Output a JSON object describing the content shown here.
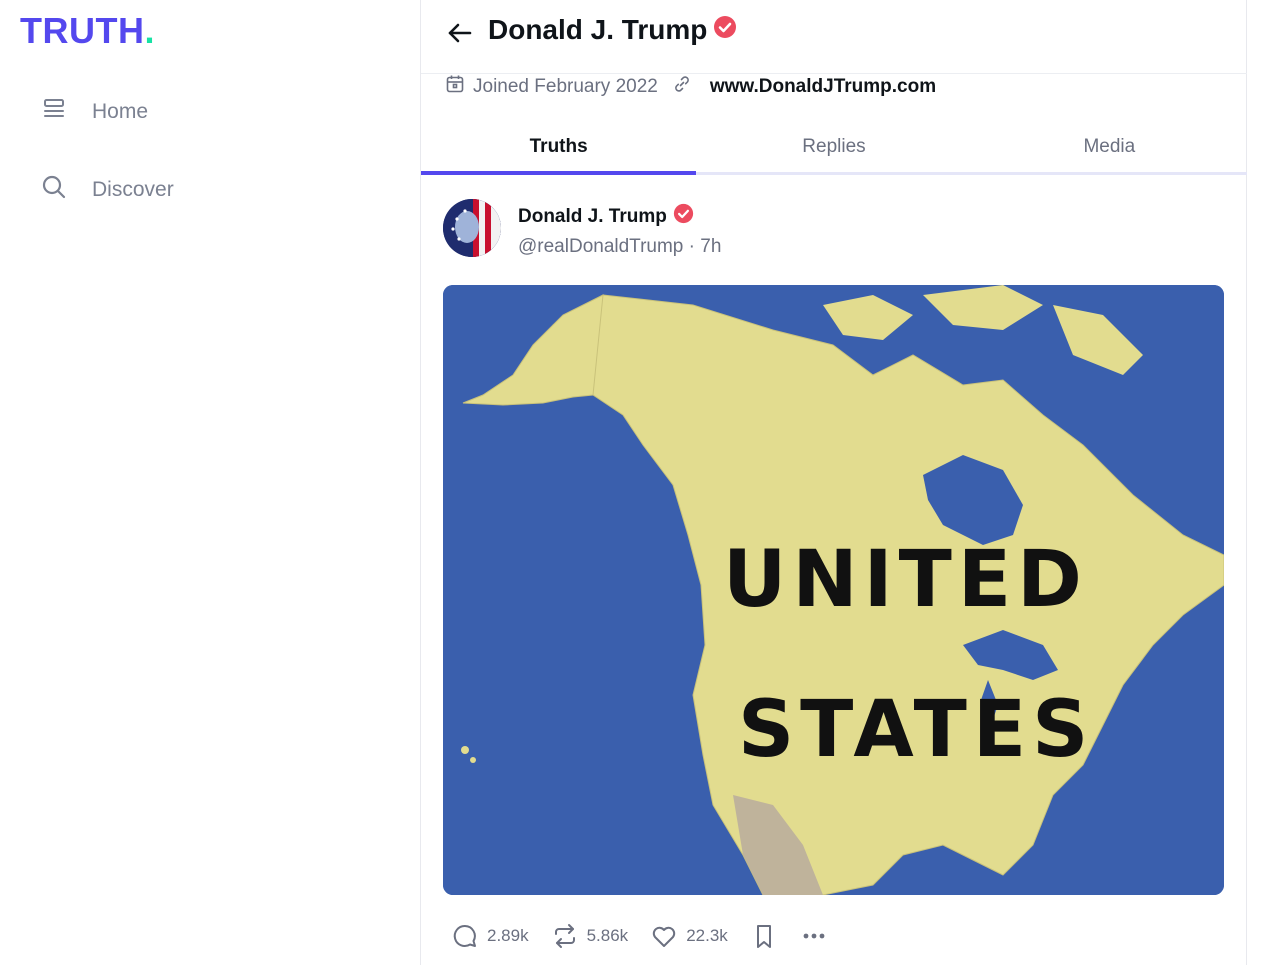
{
  "brand": {
    "logo_text": "TRUTH",
    "logo_dot": ".",
    "colors": {
      "primary": "#5448ee",
      "accent": "#17e2a5",
      "verified": "#ec4b5f"
    }
  },
  "sidebar": {
    "items": [
      {
        "label": "Home",
        "icon": "home-icon"
      },
      {
        "label": "Discover",
        "icon": "search-icon"
      }
    ]
  },
  "header": {
    "title": "Donald J. Trump",
    "back_icon": "arrow-left-icon",
    "verified_icon": "verified-badge-icon"
  },
  "profile": {
    "joined": "Joined February 2022",
    "website": "www.DonaldJTrump.com"
  },
  "tabs": [
    {
      "label": "Truths",
      "active": true
    },
    {
      "label": "Replies",
      "active": false
    },
    {
      "label": "Media",
      "active": false
    }
  ],
  "post": {
    "author": "Donald J. Trump",
    "handle_time": "@realDonaldTrump · 7h",
    "image_text_line1": "UNITED",
    "image_text_line2": "STATES",
    "actions": {
      "replies": "2.89k",
      "retruths": "5.86k",
      "likes": "22.3k"
    }
  }
}
